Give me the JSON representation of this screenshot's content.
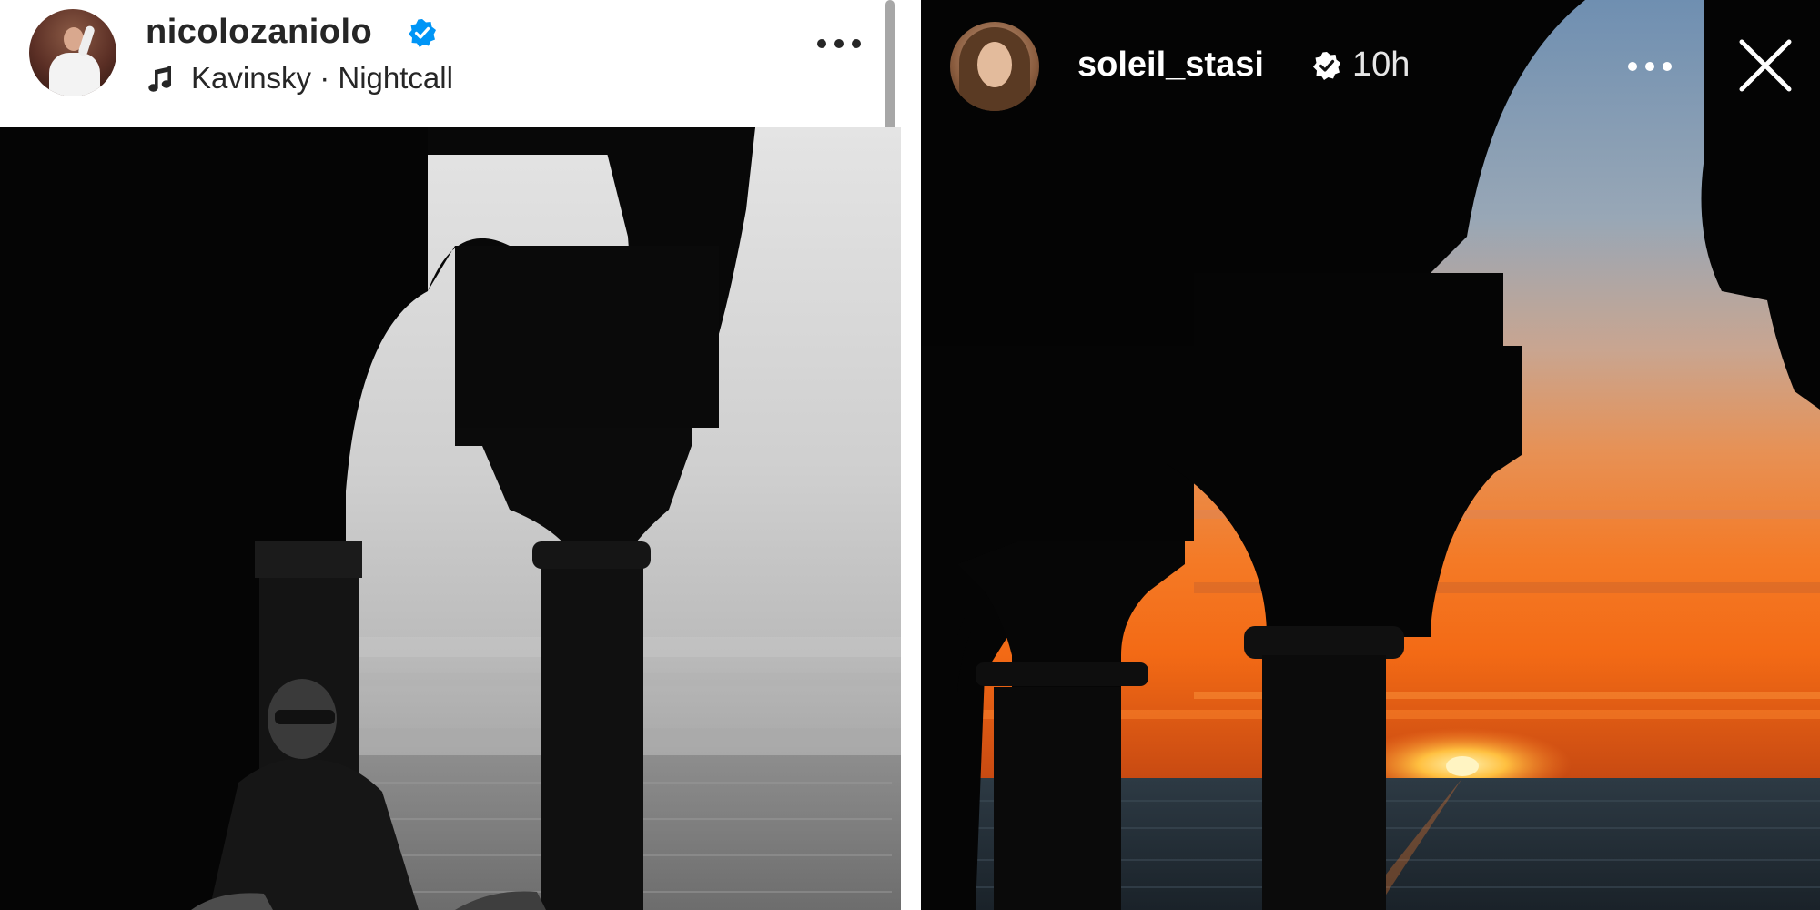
{
  "left_post": {
    "username": "nicolozaniolo",
    "verified_icon": "verified-badge-icon",
    "music": {
      "icon": "music-note-icon",
      "text": "Kavinsky · Nightcall"
    },
    "more_icon": "more-options-icon",
    "photo_description_icon": "photo"
  },
  "right_story": {
    "username": "soleil_stasi",
    "verified_icon": "verified-badge-icon",
    "time": "10h",
    "more_icon": "more-options-icon",
    "close_icon": "close-icon"
  },
  "colors": {
    "verified_blue": "#0095f6",
    "text_dark": "#262626",
    "story_text": "#ffffff",
    "sunset_orange": "#f4771f"
  }
}
